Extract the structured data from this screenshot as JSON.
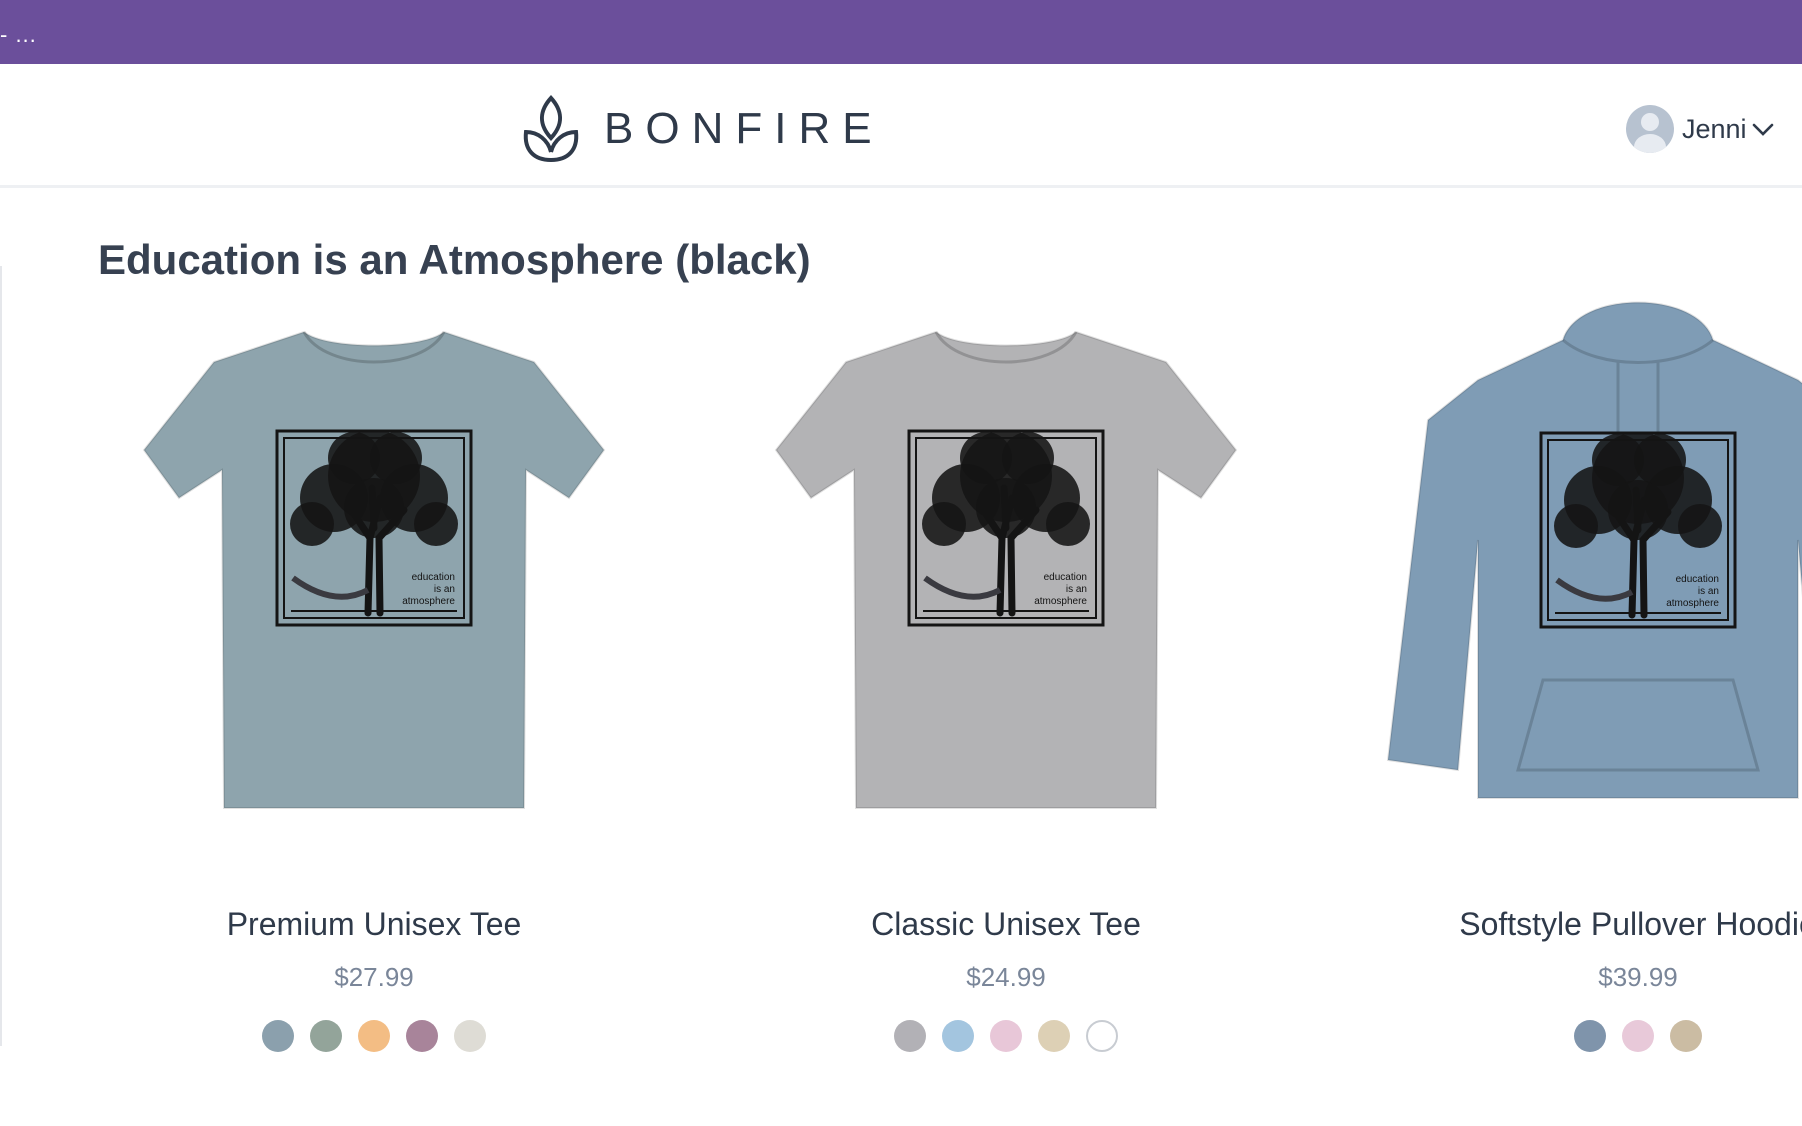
{
  "banner": {
    "text": "- ..."
  },
  "header": {
    "logo_text": "BONFIRE",
    "user": {
      "name": "Jenni"
    }
  },
  "page": {
    "title": "Education is an Atmosphere (black)"
  },
  "products": [
    {
      "name": "Premium Unisex Tee",
      "price": "$27.99",
      "garment": "tee",
      "garment_color": "#8ea4ad",
      "design_text": [
        "education",
        "is an",
        "atmosphere"
      ],
      "swatches": [
        "#8ba0ad",
        "#93a49a",
        "#f3bd84",
        "#a8849a",
        "#dedcd5"
      ]
    },
    {
      "name": "Classic Unisex Tee",
      "price": "$24.99",
      "garment": "tee",
      "garment_color": "#b3b3b5",
      "design_text": [
        "education",
        "is an",
        "atmosphere"
      ],
      "swatches": [
        "#b2b1b6",
        "#a3c5df",
        "#e8c7d8",
        "#ddd0b5",
        "#ffffff"
      ]
    },
    {
      "name": "Softstyle Pullover Hoodie",
      "price": "$39.99",
      "garment": "hoodie",
      "garment_color": "#7f9cb5",
      "design_text": [
        "education",
        "is an",
        "atmosphere"
      ],
      "swatches": [
        "#7f94ab",
        "#e8c9d9",
        "#cbbca3"
      ]
    }
  ]
}
